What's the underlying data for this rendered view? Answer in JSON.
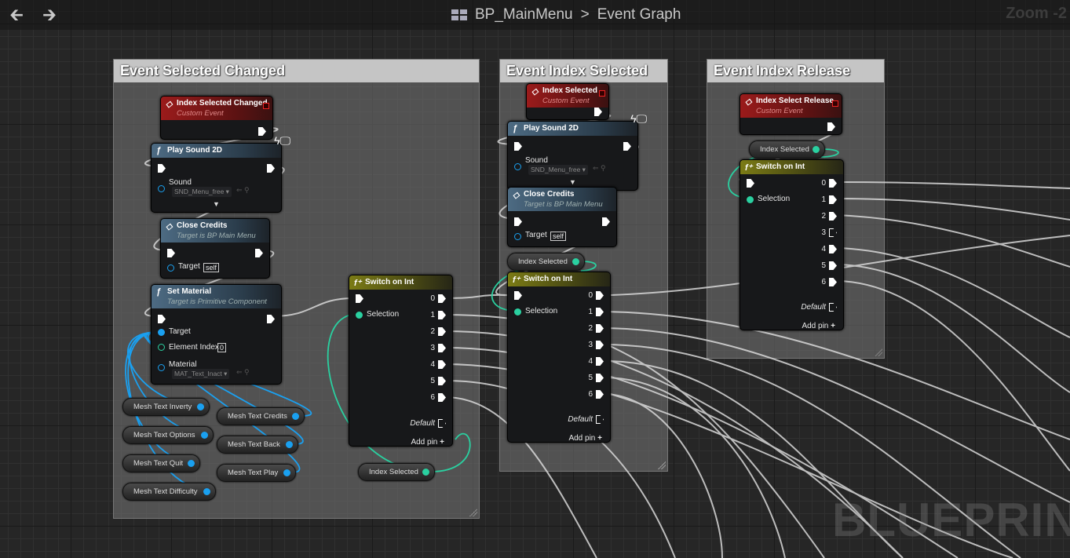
{
  "toolbar": {
    "back_icon": "arrow-left-icon",
    "forward_icon": "arrow-right-icon",
    "blueprint_name": "BP_MainMenu",
    "separator": ">",
    "graph_name": "Event Graph",
    "zoom": "Zoom -2"
  },
  "watermark": "BLUEPRINT",
  "comments": [
    {
      "title": "Event Selected Changed"
    },
    {
      "title": "Event Index Selected"
    },
    {
      "title": "Event Index Release"
    }
  ],
  "nodes": {
    "ev1": {
      "title": "Index Selected Changed",
      "subtitle": "Custom Event"
    },
    "ps1": {
      "title": "Play Sound 2D",
      "pin": "Sound",
      "value": "SND_Menu_free"
    },
    "cc1": {
      "title": "Close Credits",
      "subtitle": "Target is BP Main Menu",
      "pin": "Target",
      "value": "self"
    },
    "sm": {
      "title": "Set Material",
      "subtitle": "Target is Primitive Component",
      "pins": [
        "Target",
        "Element Index",
        "Material"
      ],
      "element_index": "0",
      "material": "MAT_Text_Inact"
    },
    "sw1": {
      "title": "Switch on Int",
      "input": "Selection",
      "outputs": [
        "0",
        "1",
        "2",
        "3",
        "4",
        "5",
        "6"
      ],
      "default": "Default",
      "add_pin": "Add pin"
    },
    "ev2": {
      "title": "Index Selected",
      "subtitle": "Custom Event"
    },
    "ps2": {
      "title": "Play Sound 2D",
      "pin": "Sound",
      "value": "SND_Menu_free"
    },
    "cc2": {
      "title": "Close Credits",
      "subtitle": "Target is BP Main Menu",
      "pin": "Target",
      "value": "self"
    },
    "sw2": {
      "title": "Switch on Int",
      "input": "Selection",
      "outputs": [
        "0",
        "1",
        "2",
        "3",
        "4",
        "5",
        "6"
      ],
      "default": "Default",
      "add_pin": "Add pin"
    },
    "ev3": {
      "title": "Index Select Release",
      "subtitle": "Custom Event"
    },
    "sw3": {
      "title": "Switch on Int",
      "input": "Selection",
      "outputs": [
        "0",
        "1",
        "2",
        "3",
        "4",
        "5",
        "6"
      ],
      "default": "Default",
      "add_pin": "Add pin"
    }
  },
  "variables": {
    "mesh_text_inverty": "Mesh Text Inverty",
    "mesh_text_options": "Mesh Text Options",
    "mesh_text_quit": "Mesh Text Quit",
    "mesh_text_difficulty": "Mesh Text Difficulty",
    "mesh_text_credits": "Mesh Text Credits",
    "mesh_text_back": "Mesh Text Back",
    "mesh_text_play": "Mesh Text Play",
    "index_selected_1": "Index Selected",
    "index_selected_2": "Index Selected",
    "index_selected_3": "Index Selected"
  },
  "colors": {
    "exec_wire": "#d8d8d8",
    "object_wire": "#1aa0f0",
    "int_wire": "#2ad0a0",
    "event_header": "#9b1b1b",
    "function_header": "#4d6b83",
    "switch_header": "#7b7b15"
  }
}
